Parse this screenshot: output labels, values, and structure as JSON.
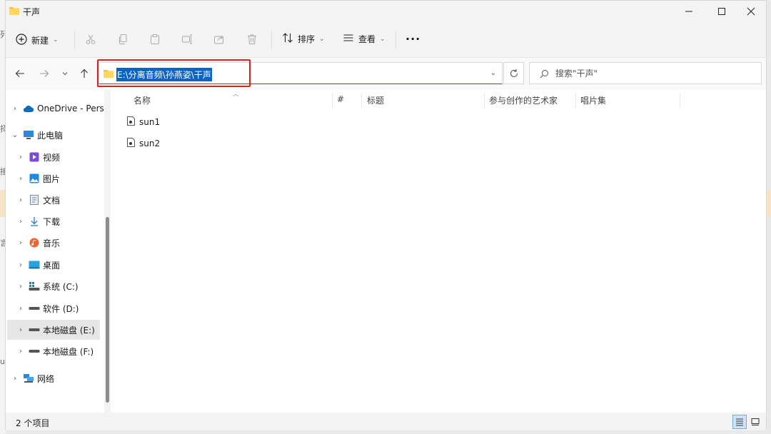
{
  "window": {
    "title": "干声"
  },
  "toolbar": {
    "new_label": "新建",
    "sort_label": "排序",
    "view_label": "查看",
    "more_label": "···"
  },
  "address": {
    "path": "E:\\分离音频\\孙燕姿\\干声"
  },
  "search": {
    "placeholder": "搜索\"干声\""
  },
  "sidebar": {
    "items": [
      {
        "label": "OneDrive - Pers",
        "icon": "cloud-icon"
      },
      {
        "label": "此电脑",
        "icon": "computer-icon"
      },
      {
        "label": "视频",
        "icon": "video-icon"
      },
      {
        "label": "图片",
        "icon": "picture-icon"
      },
      {
        "label": "文档",
        "icon": "document-icon"
      },
      {
        "label": "下载",
        "icon": "download-icon"
      },
      {
        "label": "音乐",
        "icon": "music-icon"
      },
      {
        "label": "桌面",
        "icon": "desktop-icon"
      },
      {
        "label": "系统 (C:)",
        "icon": "system-drive-icon"
      },
      {
        "label": "软件 (D:)",
        "icon": "drive-icon"
      },
      {
        "label": "本地磁盘 (E:)",
        "icon": "drive-icon"
      },
      {
        "label": "本地磁盘 (F:)",
        "icon": "drive-icon"
      },
      {
        "label": "网络",
        "icon": "network-icon"
      }
    ]
  },
  "columns": {
    "name": "名称",
    "number": "#",
    "title": "标题",
    "artist": "参与创作的艺术家",
    "album": "唱片集"
  },
  "files": [
    {
      "name": "sun1"
    },
    {
      "name": "sun2"
    }
  ],
  "status": {
    "count": "2 个项目"
  },
  "colors": {
    "accent": "#0067c0",
    "selection": "#0a64c8",
    "annotation": "#e02020"
  }
}
